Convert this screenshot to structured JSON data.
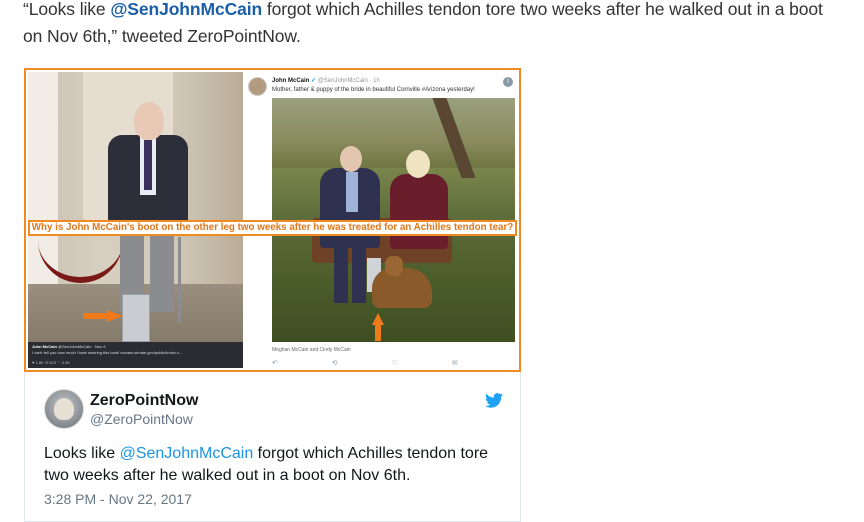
{
  "article": {
    "quote_open": "“Looks like ",
    "quote_mention": "@SenJohnMcCain",
    "quote_rest": " forgot which Achilles tendon tore two weeks after he walked out in a boot on Nov 6th,” tweeted ZeroPointNow."
  },
  "composite": {
    "headline": "Why is John McCain's boot on the other leg two weeks after he was treated for an Achilles tendon tear?",
    "left_caption": {
      "name": "John McCain",
      "handle_date": "@SenJohnMcCain · Nov 6",
      "text": "I can't tell you how much I hate wearing this boot! mccain.senate.gov/public/index.c...",
      "actions": "♥ 1.8K  ⟲ 623  ♡ 4.5K"
    },
    "right_tweet": {
      "name": "John McCain",
      "handle_time": "@SenJohnMcCain · 1h",
      "text": "Mother, father & puppy of the bride in beautiful Cornville #Arizona yesterday!",
      "caption": "Meghan McCain and Cindy McCain",
      "info_icon": "i",
      "actions": "↶ ⟲ ♡ ✉"
    },
    "border_color": "#f28a22"
  },
  "tweet": {
    "name": "ZeroPointNow",
    "handle": "@ZeroPointNow",
    "body_prefix": "Looks like ",
    "body_mention": "@SenJohnMcCain",
    "body_rest": " forgot which Achilles tendon tore two weeks after he walked out in a boot on Nov 6th.",
    "timestamp": "3:28 PM - Nov 22, 2017",
    "brand_color": "#1da1f2"
  },
  "icons": [
    "avatar",
    "twitter-bird-icon",
    "verified-icon",
    "info-icon",
    "orange-arrow-icon"
  ]
}
